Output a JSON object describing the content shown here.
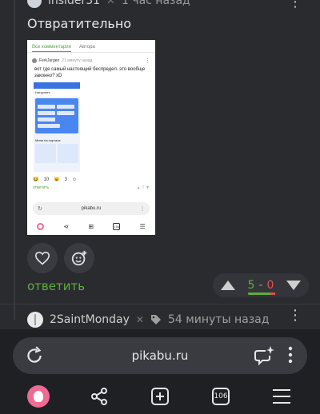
{
  "prev_comment": {
    "username": "insider31",
    "time": "1 час назад",
    "text": "Отвратительно"
  },
  "embedded_screenshot": {
    "tabs": [
      "Все комментарии",
      "Автора"
    ],
    "author": "FerkJurgen",
    "time": "21 минуту назад",
    "text": "вот где самый настоящий беспредел. это вообще законно? xD",
    "inner_bar_label": "Нагрузить",
    "section_title": "Мини на портале",
    "reactions": [
      {
        "emoji": "😂",
        "count": "10"
      },
      {
        "emoji": "😺",
        "count": "3"
      }
    ],
    "reply_label": "ответить",
    "url": "pikabu.ru"
  },
  "actions": {
    "reply_label": "ответить",
    "rating_plus": "5",
    "rating_sep": "-",
    "rating_minus": "0"
  },
  "next_comment": {
    "username": "2SaintMonday",
    "time": "54 минуты назад"
  },
  "browser": {
    "url": "pikabu.ru",
    "tabs_count": "106"
  },
  "colors": {
    "accent_green": "#5fae3c",
    "minus_red": "#e05050",
    "pikabu_pink": "#ee6b93"
  }
}
